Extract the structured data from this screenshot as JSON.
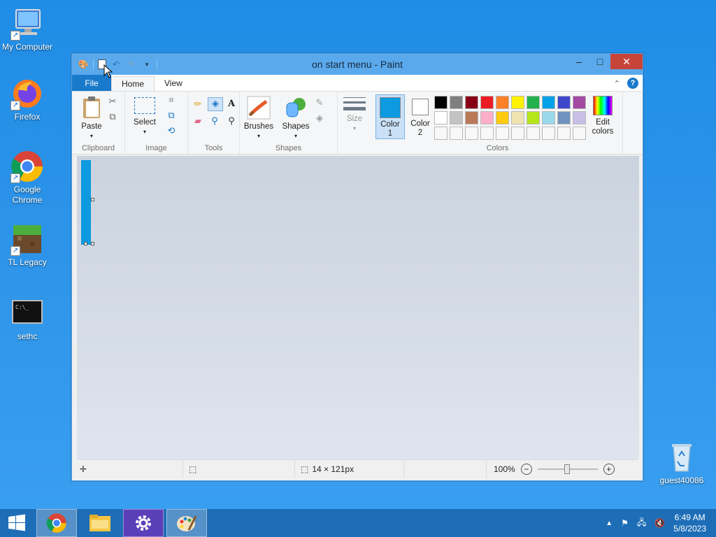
{
  "desktop": {
    "icons": [
      {
        "label": "My Computer"
      },
      {
        "label": "Firefox"
      },
      {
        "label": "Google Chrome"
      },
      {
        "label": "TL Legacy"
      },
      {
        "label": "sethc"
      },
      {
        "label": "guest40086"
      }
    ]
  },
  "window": {
    "title": "on start menu - Paint",
    "controls": {
      "minimize": "–",
      "maximize": "□",
      "close": "✕"
    }
  },
  "tabs": [
    {
      "label": "File"
    },
    {
      "label": "Home"
    },
    {
      "label": "View"
    }
  ],
  "ribbon": {
    "clipboard": {
      "paste": "Paste",
      "group": "Clipboard"
    },
    "image": {
      "select": "Select",
      "group": "Image"
    },
    "tools": {
      "group": "Tools"
    },
    "shapes": {
      "brushes": "Brushes",
      "shapes": "Shapes",
      "group": "Shapes"
    },
    "size": {
      "label": "Size"
    },
    "colors": {
      "color1": "Color 1",
      "color1_a": "Color",
      "color1_b": "1",
      "color2_a": "Color",
      "color2_b": "2",
      "edit_a": "Edit",
      "edit_b": "colors",
      "group": "Colors",
      "color1_value": "#0d9ae0",
      "color2_value": "#ffffff",
      "palette_row1": [
        "#000000",
        "#7f7f7f",
        "#880015",
        "#ed1c24",
        "#ff7f27",
        "#fff200",
        "#22b14c",
        "#00a2e8",
        "#3f48cc",
        "#a349a4"
      ],
      "palette_row2": [
        "#ffffff",
        "#c3c3c3",
        "#b97a57",
        "#ffaec9",
        "#ffc90e",
        "#efe4b0",
        "#b5e61d",
        "#99d9ea",
        "#7092be",
        "#c8bfe7"
      ]
    }
  },
  "status": {
    "dimensions": "14 × 121px",
    "zoom": "100%"
  },
  "taskbar": {
    "time": "6:49 AM",
    "date": "5/8/2023"
  }
}
